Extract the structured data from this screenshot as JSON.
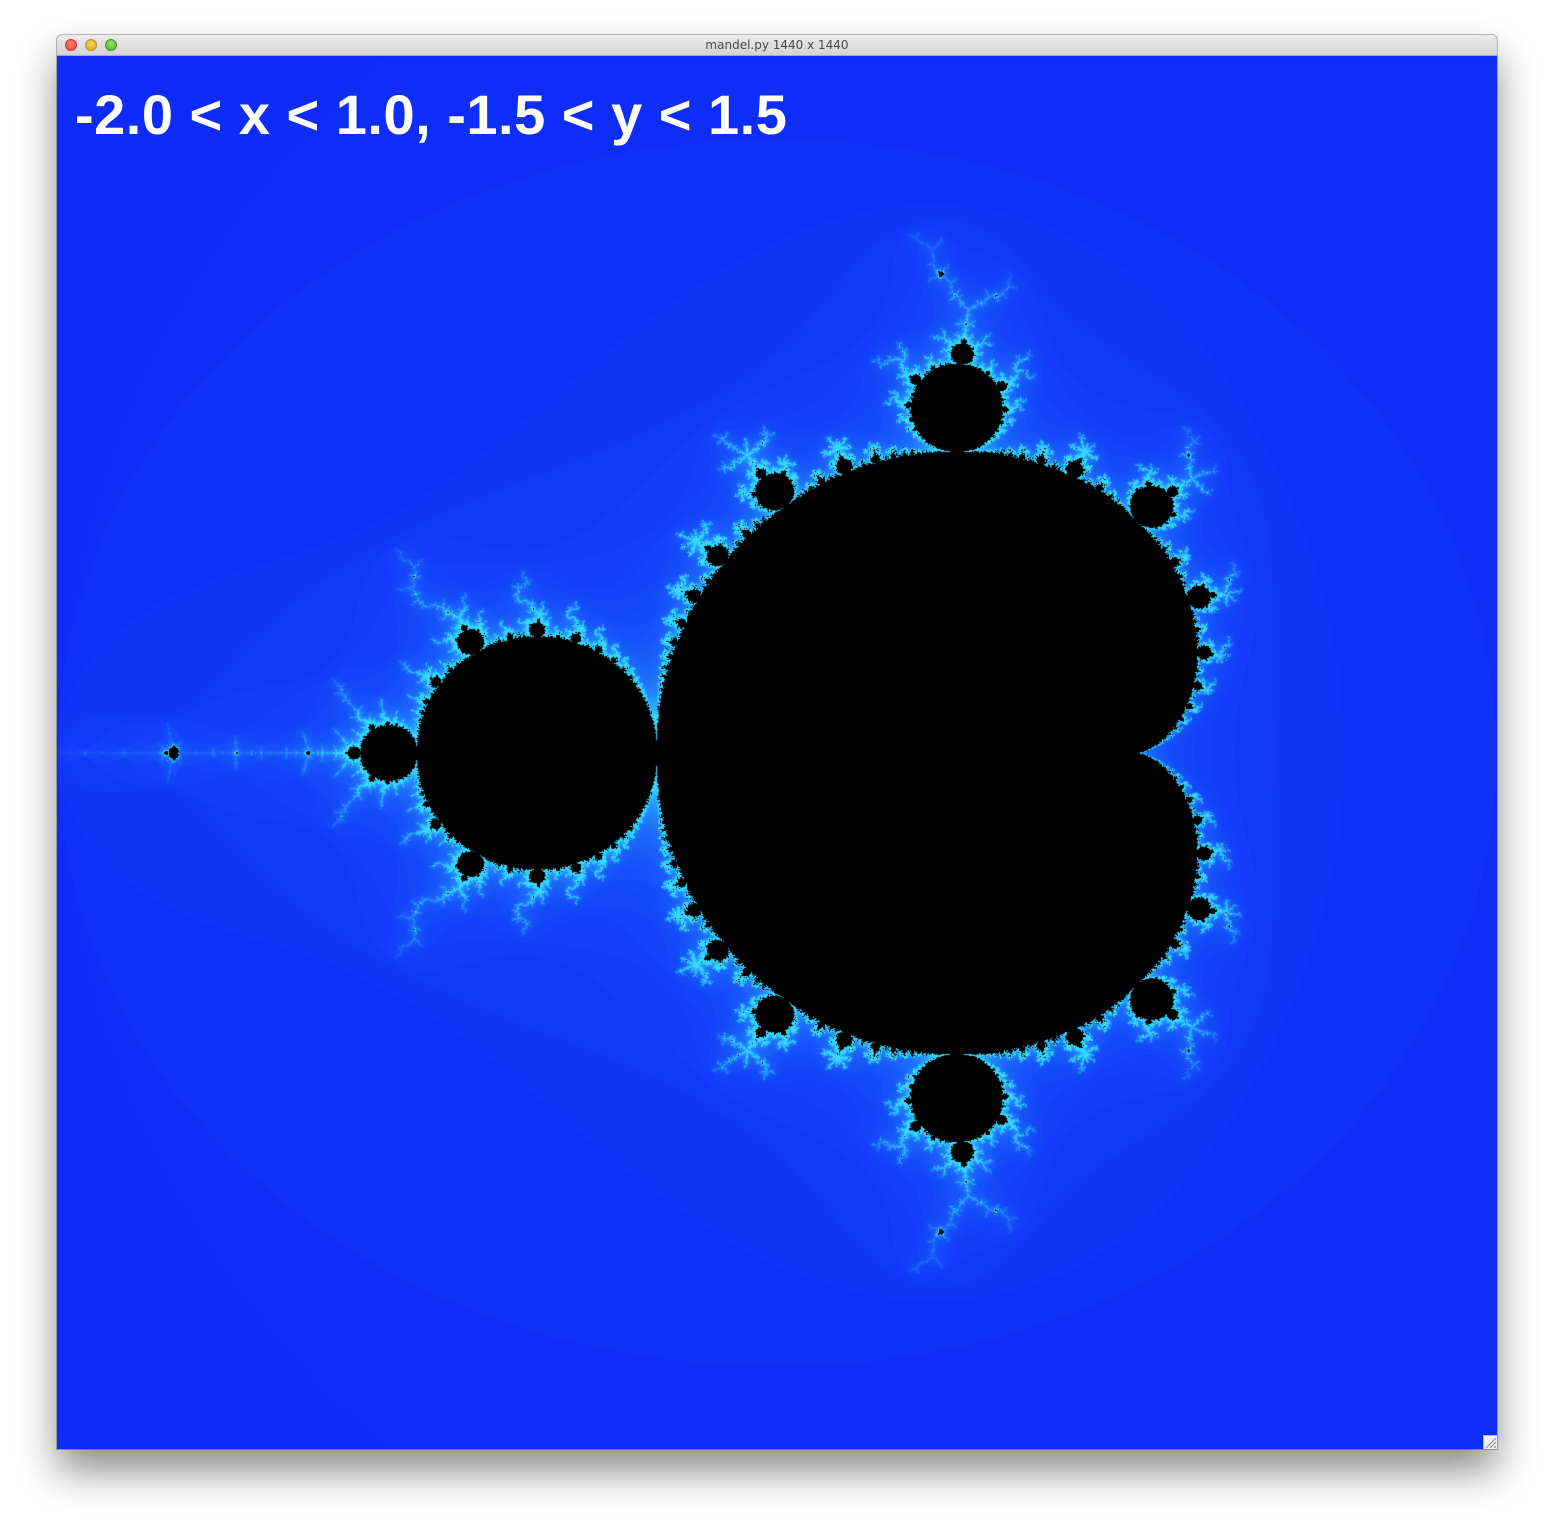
{
  "window": {
    "title": "mandel.py 1440 x 1440"
  },
  "canvas": {
    "label": "-2.0 < x < 1.0, -1.5 < y < 1.5",
    "x_min": -2.0,
    "x_max": 1.0,
    "y_min": -1.5,
    "y_max": 1.5,
    "colors": {
      "background": "#0d28f8",
      "set": "#000000",
      "edge": "#35d8ff",
      "label": "#ffffff"
    }
  },
  "icons": {
    "close": "close-button-red",
    "minimize": "minimize-button-yellow",
    "zoom": "zoom-button-green",
    "resize": "resize-grip-icon"
  }
}
